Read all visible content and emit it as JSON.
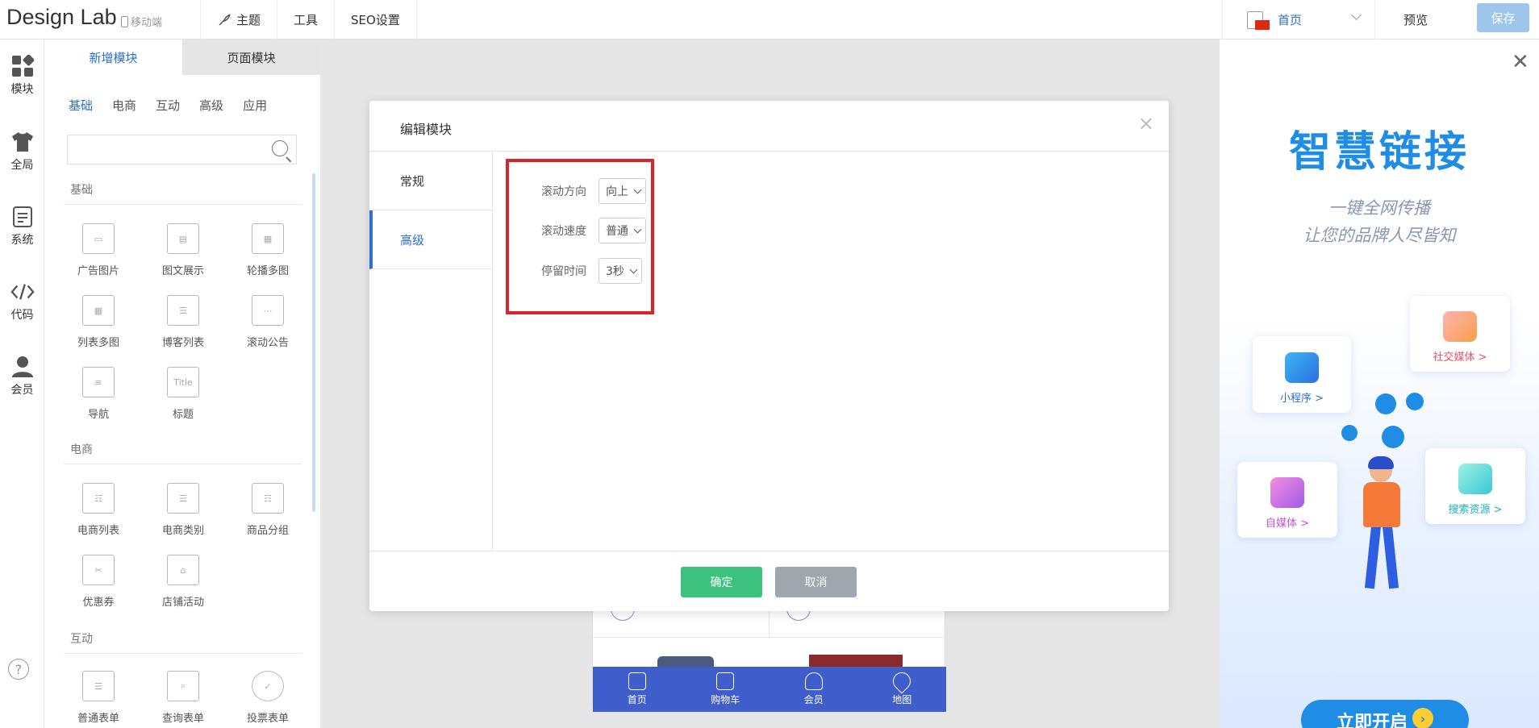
{
  "topbar": {
    "brand": "Design Lab",
    "mobile_label": "移动端",
    "nav": [
      "主题",
      "工具",
      "SEO设置"
    ],
    "page_select": "首页",
    "preview": "预览",
    "save": "保存"
  },
  "leftbar": {
    "items": [
      {
        "label": "模块",
        "icon": "modules-icon"
      },
      {
        "label": "全局",
        "icon": "shirt-icon"
      },
      {
        "label": "系统",
        "icon": "system-icon"
      },
      {
        "label": "代码",
        "icon": "code-icon"
      },
      {
        "label": "会员",
        "icon": "user-icon"
      }
    ],
    "help": "?"
  },
  "panel": {
    "tabs": [
      "新增模块",
      "页面模块"
    ],
    "subtabs": [
      "基础",
      "电商",
      "互动",
      "高级",
      "应用"
    ],
    "sections": [
      {
        "title": "基础",
        "items": [
          "广告图片",
          "图文展示",
          "轮播多图",
          "列表多图",
          "博客列表",
          "滚动公告",
          "导航",
          "标题"
        ]
      },
      {
        "title": "电商",
        "items": [
          "电商列表",
          "电商类别",
          "商品分组",
          "优惠券",
          "店铺活动"
        ]
      },
      {
        "title": "互动",
        "items": [
          "普通表单",
          "查询表单",
          "投票表单"
        ]
      }
    ],
    "title_icon_text": "Title"
  },
  "phone": {
    "tabbar": [
      "首页",
      "购物车",
      "会员",
      "地图"
    ]
  },
  "modal": {
    "title": "编辑模块",
    "tabs": [
      "常规",
      "高级"
    ],
    "active_tab": "高级",
    "fields": [
      {
        "label": "滚动方向",
        "value": "向上"
      },
      {
        "label": "滚动速度",
        "value": "普通"
      },
      {
        "label": "停留时间",
        "value": "3秒"
      }
    ],
    "ok": "确定",
    "cancel": "取消"
  },
  "ad": {
    "title": "智慧链接",
    "line1": "一键全网传播",
    "line2": "让您的品牌人尽皆知",
    "cards": [
      "小程序 >",
      "社交媒体 >",
      "自媒体 >",
      "搜索资源 >"
    ],
    "button": "立即开启"
  },
  "colors": {
    "accent": "#2d6fcf",
    "ok": "#3cc17f",
    "highlight": "#d9232d",
    "tabbar": "#3f5ecc",
    "ad_blue": "#1f8ce6"
  }
}
